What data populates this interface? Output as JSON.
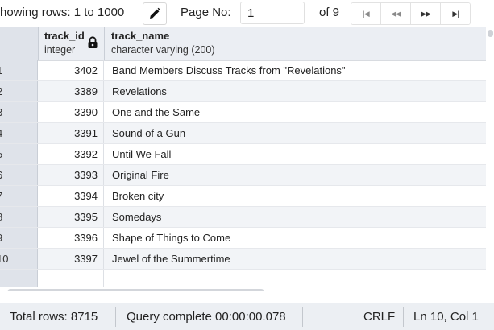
{
  "toolbar": {
    "showing_text": "howing rows: 1 to 1000",
    "edit_icon": "pencil-icon",
    "page_label": "Page No:",
    "page_value": "1",
    "of_text": "of 9",
    "nav": {
      "first_glyph": "|◀",
      "prev_glyph": "◀◀",
      "next_glyph": "▶▶",
      "last_glyph": "▶|"
    }
  },
  "grid": {
    "columns": [
      {
        "name": "track_id",
        "type": "integer",
        "icon": "lock-icon"
      },
      {
        "name": "track_name",
        "type": "character varying (200)"
      }
    ],
    "rows": [
      {
        "num": "1",
        "track_id": "3402",
        "track_name": "Band Members Discuss Tracks from \"Revelations\""
      },
      {
        "num": "2",
        "track_id": "3389",
        "track_name": "Revelations"
      },
      {
        "num": "3",
        "track_id": "3390",
        "track_name": "One and the Same"
      },
      {
        "num": "4",
        "track_id": "3391",
        "track_name": "Sound of a Gun"
      },
      {
        "num": "5",
        "track_id": "3392",
        "track_name": "Until We Fall"
      },
      {
        "num": "6",
        "track_id": "3393",
        "track_name": "Original Fire"
      },
      {
        "num": "7",
        "track_id": "3394",
        "track_name": "Broken city"
      },
      {
        "num": "8",
        "track_id": "3395",
        "track_name": "Somedays"
      },
      {
        "num": "9",
        "track_id": "3396",
        "track_name": "Shape of Things to Come"
      },
      {
        "num": "10",
        "track_id": "3397",
        "track_name": "Jewel of the Summertime"
      }
    ]
  },
  "status": {
    "total_rows": "Total rows: 8715",
    "query": "Query complete 00:00:00.078",
    "line_ending": "CRLF",
    "cursor": "Ln 10, Col 1"
  },
  "colors": {
    "header_bg": "#ebeef3",
    "alt_row_bg": "#f2f4f7",
    "rownum_bg": "#dfe3ea",
    "statusbar_bg": "#eceff3"
  }
}
